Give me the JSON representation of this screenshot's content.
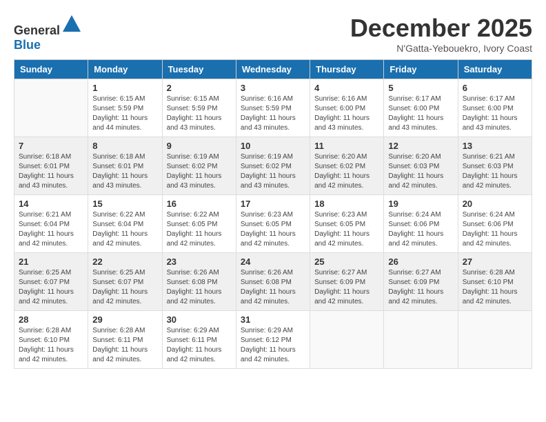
{
  "logo": {
    "text_general": "General",
    "text_blue": "Blue"
  },
  "header": {
    "month": "December 2025",
    "location": "N'Gatta-Yebouekro, Ivory Coast"
  },
  "weekdays": [
    "Sunday",
    "Monday",
    "Tuesday",
    "Wednesday",
    "Thursday",
    "Friday",
    "Saturday"
  ],
  "weeks": [
    [
      {
        "day": "",
        "sunrise": "",
        "sunset": "",
        "daylight": ""
      },
      {
        "day": "1",
        "sunrise": "Sunrise: 6:15 AM",
        "sunset": "Sunset: 5:59 PM",
        "daylight": "Daylight: 11 hours and 44 minutes."
      },
      {
        "day": "2",
        "sunrise": "Sunrise: 6:15 AM",
        "sunset": "Sunset: 5:59 PM",
        "daylight": "Daylight: 11 hours and 43 minutes."
      },
      {
        "day": "3",
        "sunrise": "Sunrise: 6:16 AM",
        "sunset": "Sunset: 5:59 PM",
        "daylight": "Daylight: 11 hours and 43 minutes."
      },
      {
        "day": "4",
        "sunrise": "Sunrise: 6:16 AM",
        "sunset": "Sunset: 6:00 PM",
        "daylight": "Daylight: 11 hours and 43 minutes."
      },
      {
        "day": "5",
        "sunrise": "Sunrise: 6:17 AM",
        "sunset": "Sunset: 6:00 PM",
        "daylight": "Daylight: 11 hours and 43 minutes."
      },
      {
        "day": "6",
        "sunrise": "Sunrise: 6:17 AM",
        "sunset": "Sunset: 6:00 PM",
        "daylight": "Daylight: 11 hours and 43 minutes."
      }
    ],
    [
      {
        "day": "7",
        "sunrise": "Sunrise: 6:18 AM",
        "sunset": "Sunset: 6:01 PM",
        "daylight": "Daylight: 11 hours and 43 minutes."
      },
      {
        "day": "8",
        "sunrise": "Sunrise: 6:18 AM",
        "sunset": "Sunset: 6:01 PM",
        "daylight": "Daylight: 11 hours and 43 minutes."
      },
      {
        "day": "9",
        "sunrise": "Sunrise: 6:19 AM",
        "sunset": "Sunset: 6:02 PM",
        "daylight": "Daylight: 11 hours and 43 minutes."
      },
      {
        "day": "10",
        "sunrise": "Sunrise: 6:19 AM",
        "sunset": "Sunset: 6:02 PM",
        "daylight": "Daylight: 11 hours and 43 minutes."
      },
      {
        "day": "11",
        "sunrise": "Sunrise: 6:20 AM",
        "sunset": "Sunset: 6:02 PM",
        "daylight": "Daylight: 11 hours and 42 minutes."
      },
      {
        "day": "12",
        "sunrise": "Sunrise: 6:20 AM",
        "sunset": "Sunset: 6:03 PM",
        "daylight": "Daylight: 11 hours and 42 minutes."
      },
      {
        "day": "13",
        "sunrise": "Sunrise: 6:21 AM",
        "sunset": "Sunset: 6:03 PM",
        "daylight": "Daylight: 11 hours and 42 minutes."
      }
    ],
    [
      {
        "day": "14",
        "sunrise": "Sunrise: 6:21 AM",
        "sunset": "Sunset: 6:04 PM",
        "daylight": "Daylight: 11 hours and 42 minutes."
      },
      {
        "day": "15",
        "sunrise": "Sunrise: 6:22 AM",
        "sunset": "Sunset: 6:04 PM",
        "daylight": "Daylight: 11 hours and 42 minutes."
      },
      {
        "day": "16",
        "sunrise": "Sunrise: 6:22 AM",
        "sunset": "Sunset: 6:05 PM",
        "daylight": "Daylight: 11 hours and 42 minutes."
      },
      {
        "day": "17",
        "sunrise": "Sunrise: 6:23 AM",
        "sunset": "Sunset: 6:05 PM",
        "daylight": "Daylight: 11 hours and 42 minutes."
      },
      {
        "day": "18",
        "sunrise": "Sunrise: 6:23 AM",
        "sunset": "Sunset: 6:05 PM",
        "daylight": "Daylight: 11 hours and 42 minutes."
      },
      {
        "day": "19",
        "sunrise": "Sunrise: 6:24 AM",
        "sunset": "Sunset: 6:06 PM",
        "daylight": "Daylight: 11 hours and 42 minutes."
      },
      {
        "day": "20",
        "sunrise": "Sunrise: 6:24 AM",
        "sunset": "Sunset: 6:06 PM",
        "daylight": "Daylight: 11 hours and 42 minutes."
      }
    ],
    [
      {
        "day": "21",
        "sunrise": "Sunrise: 6:25 AM",
        "sunset": "Sunset: 6:07 PM",
        "daylight": "Daylight: 11 hours and 42 minutes."
      },
      {
        "day": "22",
        "sunrise": "Sunrise: 6:25 AM",
        "sunset": "Sunset: 6:07 PM",
        "daylight": "Daylight: 11 hours and 42 minutes."
      },
      {
        "day": "23",
        "sunrise": "Sunrise: 6:26 AM",
        "sunset": "Sunset: 6:08 PM",
        "daylight": "Daylight: 11 hours and 42 minutes."
      },
      {
        "day": "24",
        "sunrise": "Sunrise: 6:26 AM",
        "sunset": "Sunset: 6:08 PM",
        "daylight": "Daylight: 11 hours and 42 minutes."
      },
      {
        "day": "25",
        "sunrise": "Sunrise: 6:27 AM",
        "sunset": "Sunset: 6:09 PM",
        "daylight": "Daylight: 11 hours and 42 minutes."
      },
      {
        "day": "26",
        "sunrise": "Sunrise: 6:27 AM",
        "sunset": "Sunset: 6:09 PM",
        "daylight": "Daylight: 11 hours and 42 minutes."
      },
      {
        "day": "27",
        "sunrise": "Sunrise: 6:28 AM",
        "sunset": "Sunset: 6:10 PM",
        "daylight": "Daylight: 11 hours and 42 minutes."
      }
    ],
    [
      {
        "day": "28",
        "sunrise": "Sunrise: 6:28 AM",
        "sunset": "Sunset: 6:10 PM",
        "daylight": "Daylight: 11 hours and 42 minutes."
      },
      {
        "day": "29",
        "sunrise": "Sunrise: 6:28 AM",
        "sunset": "Sunset: 6:11 PM",
        "daylight": "Daylight: 11 hours and 42 minutes."
      },
      {
        "day": "30",
        "sunrise": "Sunrise: 6:29 AM",
        "sunset": "Sunset: 6:11 PM",
        "daylight": "Daylight: 11 hours and 42 minutes."
      },
      {
        "day": "31",
        "sunrise": "Sunrise: 6:29 AM",
        "sunset": "Sunset: 6:12 PM",
        "daylight": "Daylight: 11 hours and 42 minutes."
      },
      {
        "day": "",
        "sunrise": "",
        "sunset": "",
        "daylight": ""
      },
      {
        "day": "",
        "sunrise": "",
        "sunset": "",
        "daylight": ""
      },
      {
        "day": "",
        "sunrise": "",
        "sunset": "",
        "daylight": ""
      }
    ]
  ]
}
